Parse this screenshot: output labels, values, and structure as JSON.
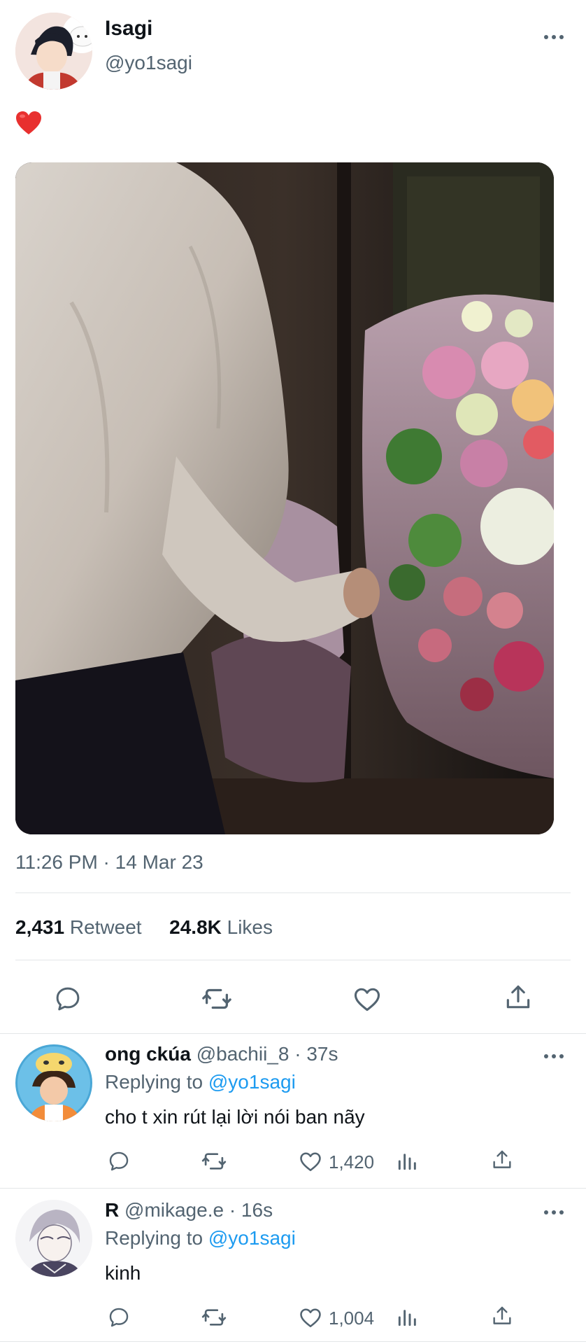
{
  "tweet": {
    "author": {
      "display_name": "Isagi",
      "handle": "@yo1sagi"
    },
    "text": "❤️",
    "timestamp": "11:26 PM · 14 Mar 23",
    "stats": {
      "retweets_count": "2,431",
      "retweets_label": "Retweet",
      "likes_count": "24.8K",
      "likes_label": "Likes"
    },
    "actions": [
      "reply-icon",
      "retweet-icon",
      "like-icon",
      "share-icon"
    ]
  },
  "replies": [
    {
      "display_name": "ong ckúa",
      "handle_time": "@bachii_8 · 37s",
      "replying_prefix": "Replying to",
      "replying_to": "@yo1sagi",
      "text": "cho t xin rút lại lời nói ban nãy",
      "like_count": "1,420"
    },
    {
      "display_name": "R",
      "handle_time": "@mikage.e · 16s",
      "replying_prefix": "Replying to",
      "replying_to": "@yo1sagi",
      "text": "kinh",
      "like_count": "1,004"
    }
  ],
  "colors": {
    "text": "#0f1419",
    "muted": "#536471",
    "link": "#1d9bf0",
    "heart": "#e0245e",
    "divider": "#e3e6e8"
  }
}
